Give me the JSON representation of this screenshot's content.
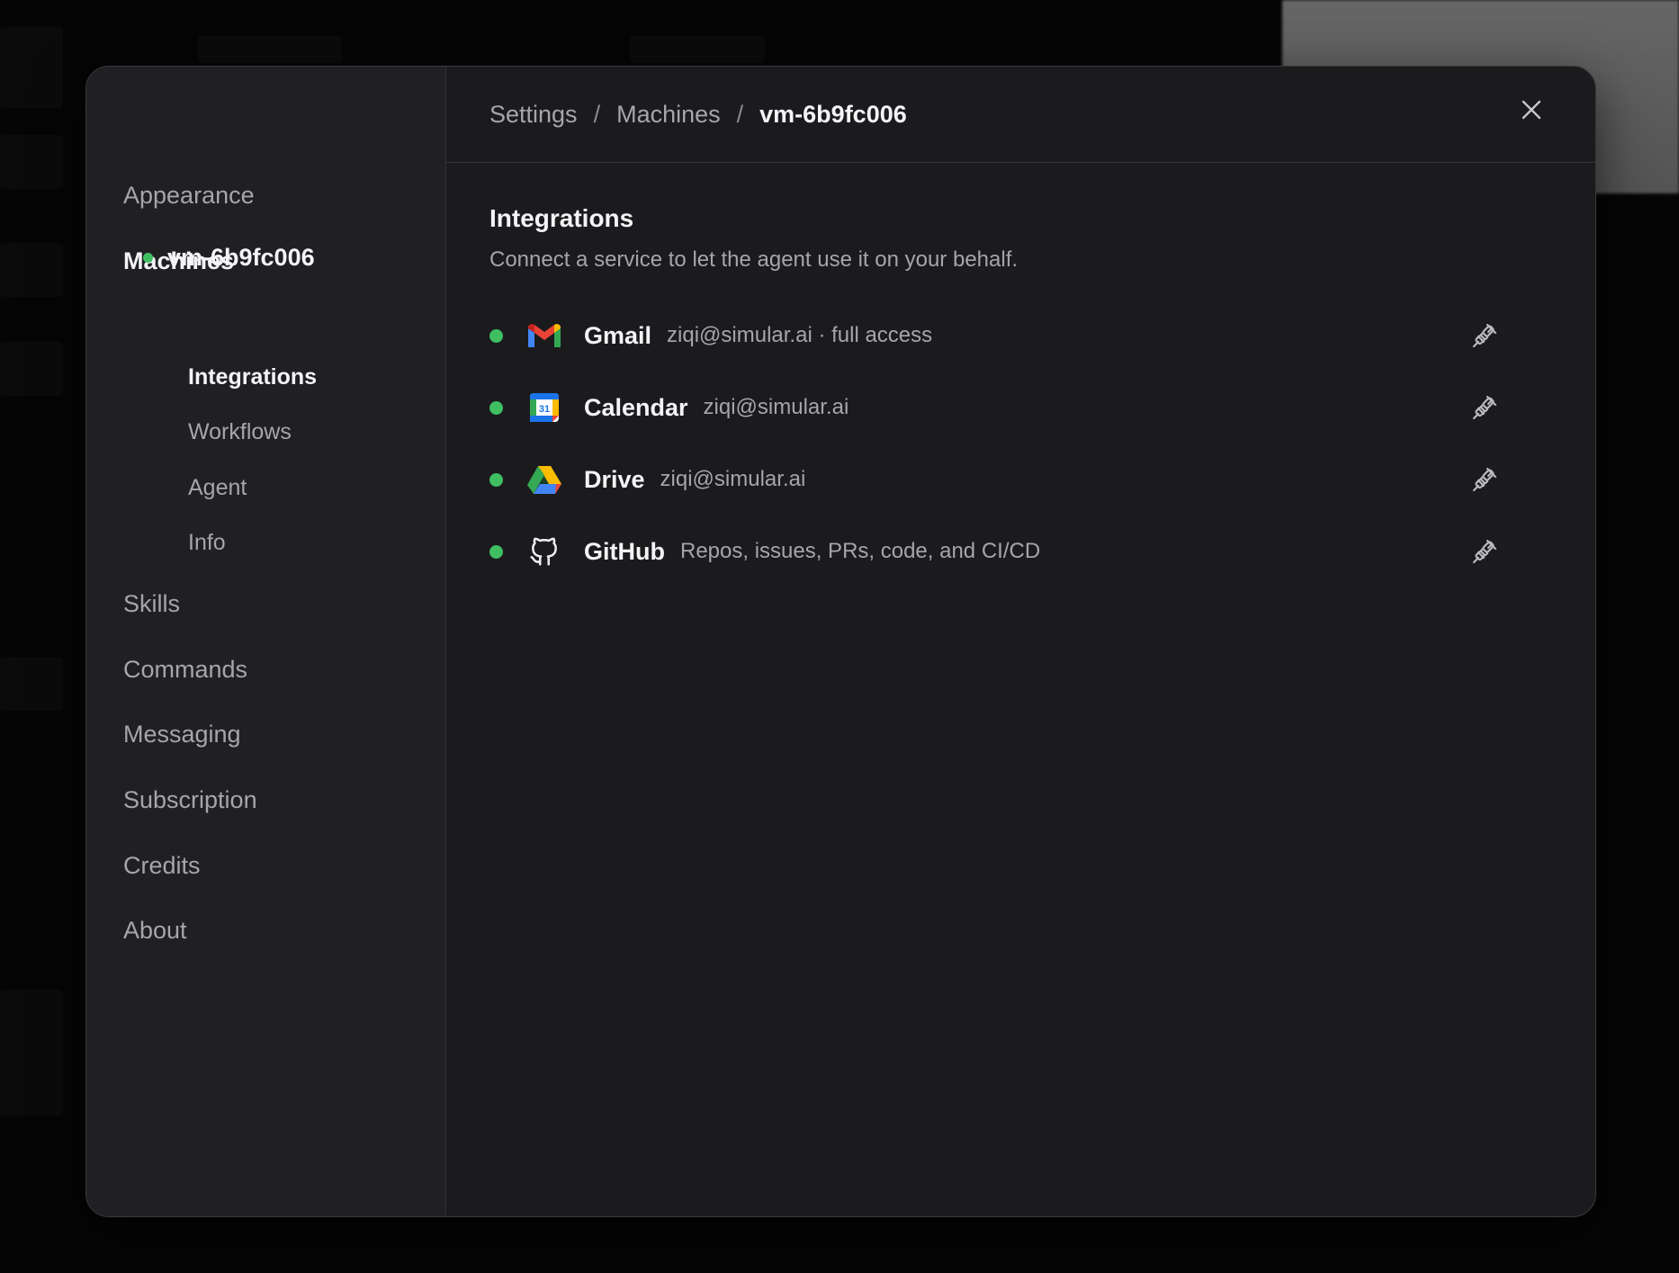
{
  "sidebar": {
    "items": [
      {
        "label": "Appearance"
      },
      {
        "label": "Machines"
      },
      {
        "label": "Skills"
      },
      {
        "label": "Commands"
      },
      {
        "label": "Messaging"
      },
      {
        "label": "Subscription"
      },
      {
        "label": "Credits"
      },
      {
        "label": "About"
      }
    ],
    "machine": {
      "label": "vm-6b9fc006",
      "status_color": "#3fbf62",
      "subitems": [
        {
          "label": "Integrations"
        },
        {
          "label": "Workflows"
        },
        {
          "label": "Agent"
        },
        {
          "label": "Info"
        }
      ]
    }
  },
  "header": {
    "breadcrumb": [
      "Settings",
      "Machines",
      "vm-6b9fc006"
    ],
    "separator": "/",
    "close_icon": "close-icon"
  },
  "section": {
    "title": "Integrations",
    "description": "Connect a service to let the agent use it on your behalf."
  },
  "integrations": [
    {
      "name": "Gmail",
      "detail": "ziqi@simular.ai · full access",
      "icon": "gmail-icon",
      "status": "connected"
    },
    {
      "name": "Calendar",
      "detail": "ziqi@simular.ai",
      "icon": "google-calendar-icon",
      "status": "connected",
      "icon_text": "31"
    },
    {
      "name": "Drive",
      "detail": "ziqi@simular.ai",
      "icon": "google-drive-icon",
      "status": "connected"
    },
    {
      "name": "GitHub",
      "detail": "Repos, issues, PRs, code, and CI/CD",
      "icon": "github-icon",
      "status": "connected"
    }
  ],
  "colors": {
    "accent_green": "#3fbf62",
    "panel_bg": "#1b1b1d",
    "sidebar_bg": "#202023"
  }
}
